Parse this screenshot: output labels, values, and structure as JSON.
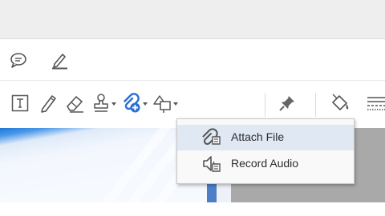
{
  "toolbar": {
    "comment_row": [
      {
        "icon": "speech-bubble-icon"
      },
      {
        "icon": "highlighter-pen-icon"
      }
    ],
    "tools_row": [
      {
        "icon": "text-box-icon"
      },
      {
        "icon": "pencil-icon"
      },
      {
        "icon": "eraser-icon"
      },
      {
        "icon": "stamp-icon",
        "has_dropdown": true
      },
      {
        "icon": "paperclip-icon",
        "has_dropdown": true,
        "active": true
      },
      {
        "icon": "shapes-icon",
        "has_dropdown": true
      },
      {
        "icon": "pin-icon"
      },
      {
        "icon": "paint-bucket-icon"
      },
      {
        "icon": "line-style-icon"
      }
    ]
  },
  "attach_menu": {
    "items": [
      {
        "label": "Attach File",
        "icon": "attach-file-icon",
        "highlighted": true
      },
      {
        "label": "Record Audio",
        "icon": "record-audio-icon",
        "highlighted": false
      }
    ]
  },
  "colors": {
    "accent": "#2a6fd6",
    "menu_highlight": "#dfe8f3",
    "icon": "#555555"
  }
}
